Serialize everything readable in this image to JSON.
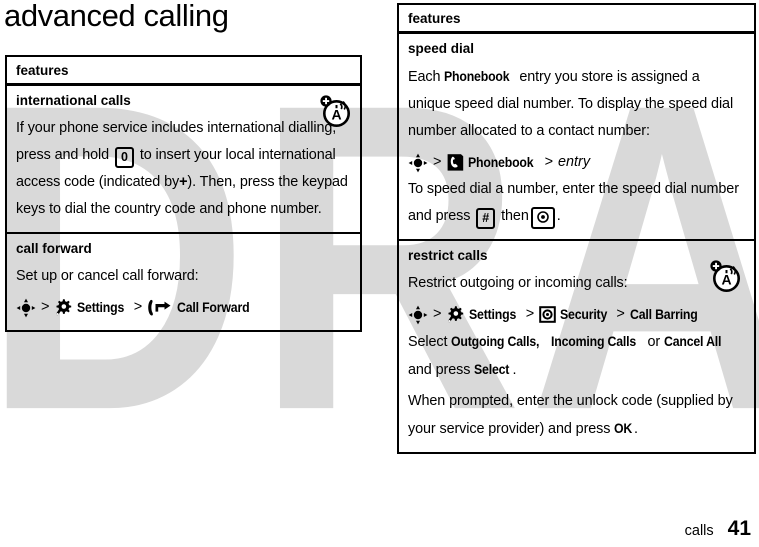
{
  "page": {
    "title": "advanced calling",
    "footer_section": "calls",
    "footer_page_number": "41"
  },
  "watermark": {
    "text": "DRAFT",
    "color": "#d9d9d9"
  },
  "left_table": {
    "header": "features",
    "rows": [
      {
        "title": "international calls",
        "margin_icon": "roaming-network-icon",
        "body_part1": "If your phone service includes international dialling, press and hold",
        "key1": "0",
        "body_part2": "to insert your local international access code (indicated by",
        "plus": "+",
        "body_part3": "). Then, press the keypad keys to dial the country code and phone number."
      },
      {
        "title": "call forward",
        "intro": "Set up or cancel call forward:",
        "nav": {
          "center_key_icon": "navigation-key-icon",
          "sep1": ">",
          "settings_icon": "settings-gear-icon",
          "settings_label": "Settings",
          "sep2": ">",
          "callforward_icon": "call-forward-icon",
          "callforward_label": "Call Forward"
        }
      }
    ]
  },
  "right_table": {
    "header": "features",
    "rows": [
      {
        "title": "speed dial",
        "body_part1": "Each",
        "phonebook_label": "Phonebook",
        "body_part2": "entry you store is assigned a unique speed dial number. To display the speed dial number allocated to a contact number:",
        "nav": {
          "center_key_icon": "navigation-key-icon",
          "sep1": ">",
          "phonebook_icon": "phonebook-icon",
          "phonebook_label": "Phonebook",
          "sep2": ">",
          "entry_label": "entry"
        },
        "body_part3": "To speed dial a number, enter the speed dial number and press",
        "key_hash": "#",
        "body_part4": "then",
        "key_send": "send-key-icon",
        "body_part5": "."
      },
      {
        "title": "restrict calls",
        "margin_icon": "roaming-network-icon",
        "intro": "Restrict outgoing or incoming calls:",
        "nav": {
          "center_key_icon": "navigation-key-icon",
          "sep1": ">",
          "settings_icon": "settings-gear-icon",
          "settings_label": "Settings",
          "sep2": ">",
          "security_icon": "security-icon",
          "security_label": "Security",
          "sep3": ">",
          "callbarring_label": "Call Barring"
        },
        "select_part1": "Select",
        "opt1": "Outgoing Calls,",
        "opt2": "Incoming Calls",
        "select_or": "or",
        "opt3": "Cancel All",
        "select_part2": "and press",
        "select_btn": "Select",
        "select_period": ".",
        "unlock_part1": "When prompted, enter the unlock code (supplied by your service provider) and press",
        "unlock_btn": "OK",
        "unlock_period": "."
      }
    ]
  }
}
